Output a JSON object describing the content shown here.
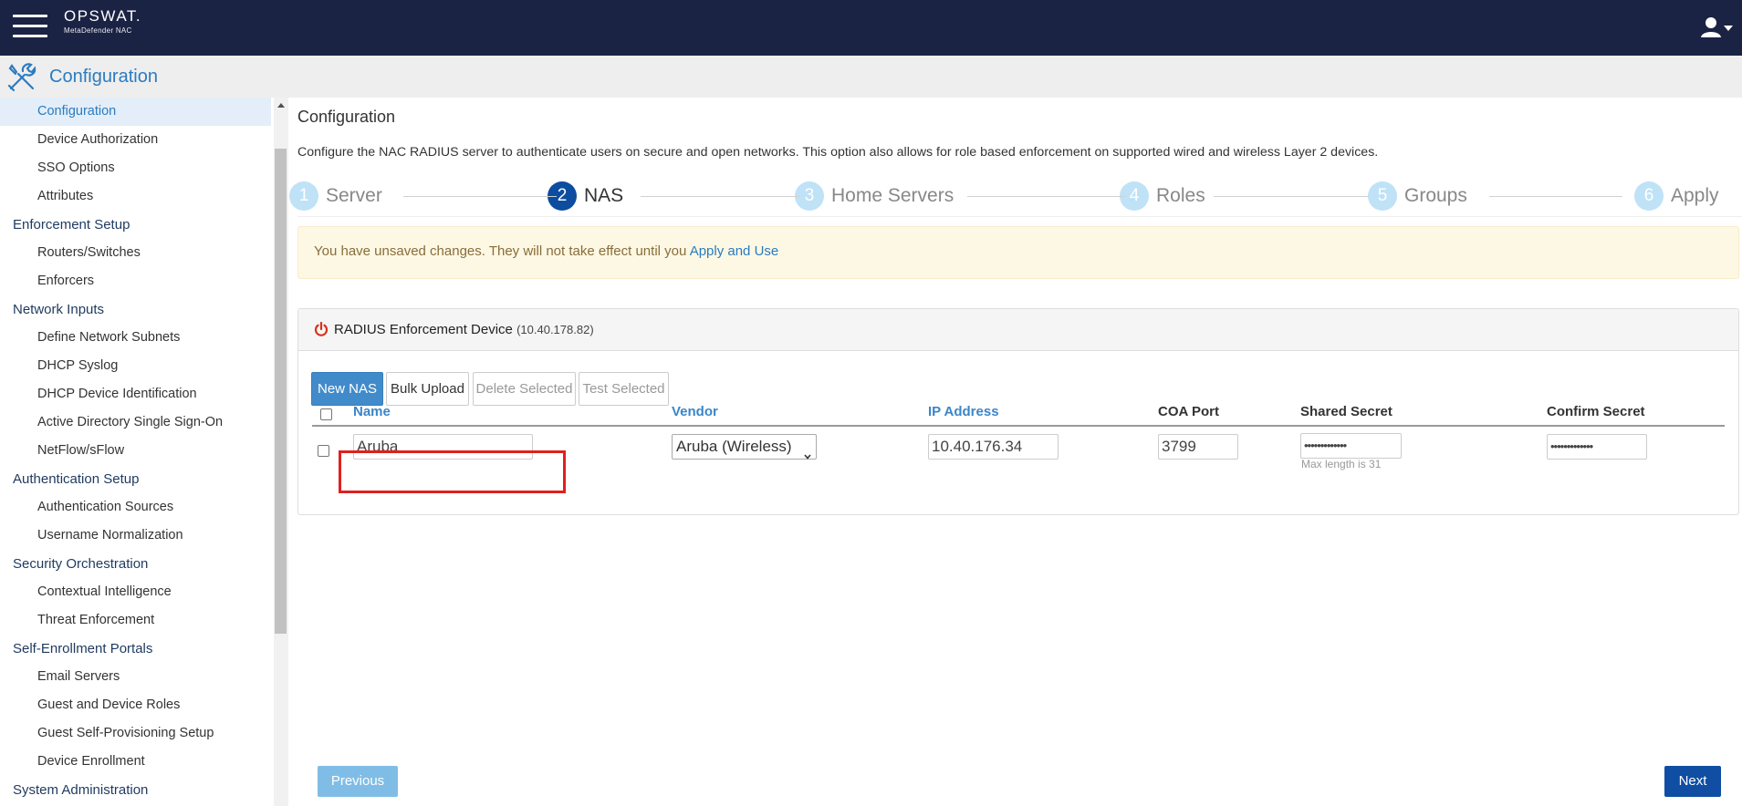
{
  "header": {
    "brand_name": "OPSWAT.",
    "brand_sub": "MetaDefender NAC"
  },
  "config_header": {
    "title": "Configuration"
  },
  "sidebar": {
    "items": [
      {
        "type": "item",
        "label": "Configuration",
        "active": true
      },
      {
        "type": "item",
        "label": "Device Authorization"
      },
      {
        "type": "item",
        "label": "SSO Options"
      },
      {
        "type": "item",
        "label": "Attributes"
      },
      {
        "type": "section",
        "label": "Enforcement Setup"
      },
      {
        "type": "item",
        "label": "Routers/Switches"
      },
      {
        "type": "item",
        "label": "Enforcers"
      },
      {
        "type": "section",
        "label": "Network Inputs"
      },
      {
        "type": "item",
        "label": "Define Network Subnets"
      },
      {
        "type": "item",
        "label": "DHCP Syslog"
      },
      {
        "type": "item",
        "label": "DHCP Device Identification"
      },
      {
        "type": "item",
        "label": "Active Directory Single Sign-On"
      },
      {
        "type": "item",
        "label": "NetFlow/sFlow"
      },
      {
        "type": "section",
        "label": "Authentication Setup"
      },
      {
        "type": "item",
        "label": "Authentication Sources"
      },
      {
        "type": "item",
        "label": "Username Normalization"
      },
      {
        "type": "section",
        "label": "Security Orchestration"
      },
      {
        "type": "item",
        "label": "Contextual Intelligence"
      },
      {
        "type": "item",
        "label": "Threat Enforcement"
      },
      {
        "type": "section",
        "label": "Self-Enrollment Portals"
      },
      {
        "type": "item",
        "label": "Email Servers"
      },
      {
        "type": "item",
        "label": "Guest and Device Roles"
      },
      {
        "type": "item",
        "label": "Guest Self-Provisioning Setup"
      },
      {
        "type": "item",
        "label": "Device Enrollment"
      },
      {
        "type": "section",
        "label": "System Administration"
      }
    ]
  },
  "main": {
    "title": "Configuration",
    "description": "Configure the NAC RADIUS server to authenticate users on secure and open networks. This option also allows for role based enforcement on supported wired and wireless Layer 2 devices.",
    "wizard": {
      "current_step": 2,
      "steps": [
        {
          "num": "1",
          "label": "Server"
        },
        {
          "num": "2",
          "label": "NAS"
        },
        {
          "num": "3",
          "label": "Home Servers"
        },
        {
          "num": "4",
          "label": "Roles"
        },
        {
          "num": "5",
          "label": "Groups"
        },
        {
          "num": "6",
          "label": "Apply"
        }
      ]
    },
    "alert": {
      "text": "You have unsaved changes. They will not take effect until you ",
      "link": "Apply and Use"
    },
    "panel": {
      "title": "RADIUS Enforcement Device",
      "ip": "(10.40.178.82)",
      "buttons": {
        "new_nas": "New NAS",
        "bulk_upload": "Bulk Upload",
        "delete_selected": "Delete Selected",
        "test_selected": "Test Selected"
      },
      "columns": {
        "name": "Name",
        "vendor": "Vendor",
        "ip_address": "IP Address",
        "coa_port": "COA Port",
        "shared_secret": "Shared Secret",
        "confirm_secret": "Confirm Secret"
      },
      "row": {
        "name": "Aruba",
        "vendor": "Aruba (Wireless)",
        "ip_address": "10.40.176.34",
        "coa_port": "3799",
        "shared_secret": "•••••••••••••",
        "confirm_secret": "•••••••••••••",
        "secret_help": "Max length is 31"
      }
    },
    "nav": {
      "previous": "Previous",
      "next": "Next"
    }
  },
  "colors": {
    "topbar": "#1b2344",
    "accent": "#2b7bc0",
    "wizard_current": "#0d4da0",
    "wizard_inactive": "#bfe2f7",
    "highlight": "#e0201e"
  }
}
